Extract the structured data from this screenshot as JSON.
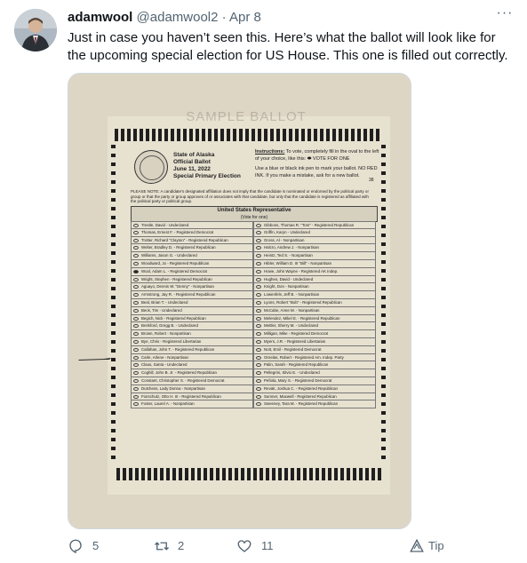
{
  "tweet": {
    "display_name": "adamwool",
    "handle": "@adamwool2",
    "separator": "·",
    "time": "Apr 8",
    "more": "···",
    "text": "Just in case you haven’t seen this.  Here’s what the ballot will look like for the upcoming special election for US House. This one is filled out correctly."
  },
  "ballot": {
    "watermark": "SAMPLE BALLOT",
    "title_lines": [
      "State of Alaska",
      "Official Ballot",
      "June 11, 2022",
      "Special Primary Election"
    ],
    "instructions_head": "Instructions:",
    "instructions_line1": " To vote, completely fill in the oval to the left of your choice, like this: ⬬ VOTE FOR ONE",
    "instructions_line2": "Use a blue or black ink pen to mark your ballot. NO RED INK. If you make a mistake, ask for a new ballot.",
    "page_number": "38",
    "notice": "PLEASE NOTE: A candidate's designated affiliation does not imply that the candidate is nominated or endorsed by the political party or group or that the party or group approves of or associates with that candidate, but only that the candidate is registered as affiliated with the political party or political group.",
    "office_title": "United States Representative",
    "office_subtitle": "(Vote for one)",
    "left_candidates": [
      {
        "name": "Trestle, David - Undeclared",
        "filled": false
      },
      {
        "name": "Thomas, Ernest F. - Registered Democrat",
        "filled": false
      },
      {
        "name": "Trotter, Richard \"Clayton\" - Registered Republican",
        "filled": false
      },
      {
        "name": "Welter, Bradley D. - Registered Republican",
        "filled": false
      },
      {
        "name": "Williams, Jason G. - Undeclared",
        "filled": false
      },
      {
        "name": "Woodward, Jo - Registered Republican",
        "filled": false
      },
      {
        "name": "Wool, Adam L. - Registered Democrat",
        "filled": true
      },
      {
        "name": "Wright, Stephen - Registered Republican",
        "filled": false
      },
      {
        "name": "Aguayo, Dennis W. \"Denny\" - Nonpartisan",
        "filled": false
      },
      {
        "name": "Armstrong, Jay R. - Registered Republican",
        "filled": false
      },
      {
        "name": "Beal, Brian T. - Undeclared",
        "filled": false
      },
      {
        "name": "Beck, Tim - Undeclared",
        "filled": false
      },
      {
        "name": "Begich, Nick - Registered Republican",
        "filled": false
      },
      {
        "name": "Brelsford, Gregg B. - Undeclared",
        "filled": false
      },
      {
        "name": "Brown, Robert - Nonpartisan",
        "filled": false
      },
      {
        "name": "Bye, Chris - Registered Libertarian",
        "filled": false
      },
      {
        "name": "Callahan, John T. - Registered Republican",
        "filled": false
      },
      {
        "name": "Carle, Arlene - Nonpartisan",
        "filled": false
      },
      {
        "name": "Claus, Santa - Undeclared",
        "filled": false
      },
      {
        "name": "Coghill, John B. Jr. - Registered Republican",
        "filled": false
      },
      {
        "name": "Constant, Christopher S. - Registered Democrat",
        "filled": false
      },
      {
        "name": "Dutchess, Lady Donna - Nonpartisan",
        "filled": false
      },
      {
        "name": "Fiorschutz, Otto H. III - Registered Republican",
        "filled": false
      },
      {
        "name": "Foster, Laurel A. - Nonpartisan",
        "filled": false
      }
    ],
    "right_candidates": [
      {
        "name": "Gibbons, Thomas R. \"Tom\" - Registered Republican",
        "filled": false
      },
      {
        "name": "Griffin, Karyn - Undeclared",
        "filled": false
      },
      {
        "name": "Gross, Al - Nonpartisan",
        "filled": false
      },
      {
        "name": "Halcro, Andrew J. - Nonpartisan",
        "filled": false
      },
      {
        "name": "Heintz, Ted S. - Nonpartisan",
        "filled": false
      },
      {
        "name": "Hibler, William D. III \"Bill\" - Nonpartisan",
        "filled": false
      },
      {
        "name": "Howe, John Wayne - Registered AK Indep.",
        "filled": false
      },
      {
        "name": "Hughes, David - Undeclared",
        "filled": false
      },
      {
        "name": "Knight, Don - Nonpartisan",
        "filled": false
      },
      {
        "name": "Lowenfels, Jeff B. - Nonpartisan",
        "filled": false
      },
      {
        "name": "Lyons, Robert \"Bob\" - Registered Republican",
        "filled": false
      },
      {
        "name": "McCabe, Anne M. - Nonpartisan",
        "filled": false
      },
      {
        "name": "Melendez, Mikel E. - Registered Republican",
        "filled": false
      },
      {
        "name": "Mettler, Sherry M. - Undeclared",
        "filled": false
      },
      {
        "name": "Milligan, Mike - Registered Democrat",
        "filled": false
      },
      {
        "name": "Myers, J.R. - Registered Libertarian",
        "filled": false
      },
      {
        "name": "Nott, Emil - Registered Democrat",
        "filled": false
      },
      {
        "name": "Ornelas, Robert - Registered Am. Indep. Party",
        "filled": false
      },
      {
        "name": "Palin, Sarah - Registered Republican",
        "filled": false
      },
      {
        "name": "Pellegrini, Silvio E. - Undeclared",
        "filled": false
      },
      {
        "name": "Pefiola, Mary S. - Registered Democrat",
        "filled": false
      },
      {
        "name": "Revak, Joshua C. - Registered Republican",
        "filled": false
      },
      {
        "name": "Sumner, Maxwell - Registered Republican",
        "filled": false
      },
      {
        "name": "Sweeney, Tara M. - Registered Republican",
        "filled": false
      }
    ]
  },
  "actions": {
    "replies": "5",
    "retweets": "2",
    "likes": "11",
    "tip": "Tip"
  },
  "colors": {
    "text": "#0f1419",
    "secondary": "#536471",
    "border": "#cfd9de"
  },
  "icons": [
    "more-icon",
    "reply-icon",
    "retweet-icon",
    "like-icon",
    "tip-icon"
  ]
}
